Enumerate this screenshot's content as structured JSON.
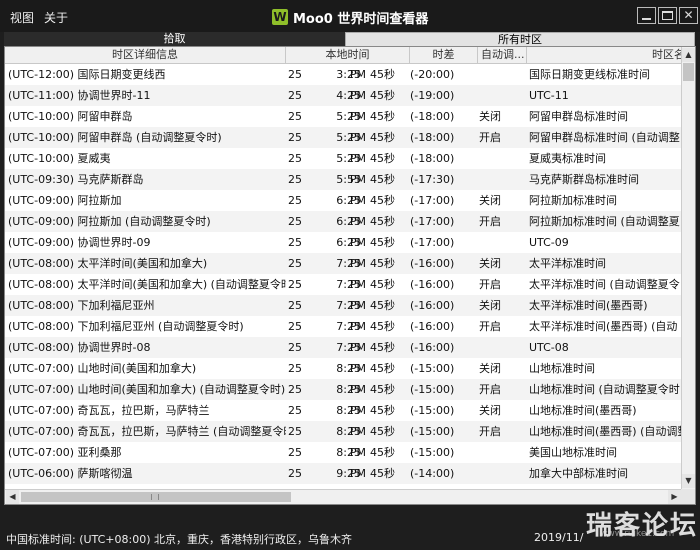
{
  "menu": {
    "view": "视图",
    "about": "关于"
  },
  "app": {
    "title": "Moo0 世界时间查看器",
    "logo_letter": "W",
    "logo_color": "#8fbf2a"
  },
  "tabs": [
    {
      "label": "拾取"
    },
    {
      "label": "所有时区"
    }
  ],
  "columns": {
    "name": "时区详细信息",
    "local": "本地时间",
    "offset": "时差",
    "dst": "自动调...",
    "zone": "时区名"
  },
  "rows": [
    {
      "name": "(UTC-12:00) 国际日期变更线西",
      "day": "25",
      "time": "3:25",
      "ampm": "PM",
      "sec": "45秒",
      "offset": "(-20:00)",
      "dst": "",
      "zone": "国际日期变更线标准时间"
    },
    {
      "name": "(UTC-11:00) 协调世界时-11",
      "day": "25",
      "time": "4:25",
      "ampm": "PM",
      "sec": "45秒",
      "offset": "(-19:00)",
      "dst": "",
      "zone": "UTC-11"
    },
    {
      "name": "(UTC-10:00) 阿留申群岛",
      "day": "25",
      "time": "5:25",
      "ampm": "PM",
      "sec": "45秒",
      "offset": "(-18:00)",
      "dst": "关闭",
      "zone": "阿留申群岛标准时间"
    },
    {
      "name": "(UTC-10:00) 阿留申群岛 (自动调整夏令时)",
      "day": "25",
      "time": "5:25",
      "ampm": "PM",
      "sec": "45秒",
      "offset": "(-18:00)",
      "dst": "开启",
      "zone": "阿留申群岛标准时间 (自动调整"
    },
    {
      "name": "(UTC-10:00) 夏威夷",
      "day": "25",
      "time": "5:25",
      "ampm": "PM",
      "sec": "45秒",
      "offset": "(-18:00)",
      "dst": "",
      "zone": "夏威夷标准时间"
    },
    {
      "name": "(UTC-09:30) 马克萨斯群岛",
      "day": "25",
      "time": "5:55",
      "ampm": "PM",
      "sec": "45秒",
      "offset": "(-17:30)",
      "dst": "",
      "zone": "马克萨斯群岛标准时间"
    },
    {
      "name": "(UTC-09:00) 阿拉斯加",
      "day": "25",
      "time": "6:25",
      "ampm": "PM",
      "sec": "45秒",
      "offset": "(-17:00)",
      "dst": "关闭",
      "zone": "阿拉斯加标准时间"
    },
    {
      "name": "(UTC-09:00) 阿拉斯加 (自动调整夏令时)",
      "day": "25",
      "time": "6:25",
      "ampm": "PM",
      "sec": "45秒",
      "offset": "(-17:00)",
      "dst": "开启",
      "zone": "阿拉斯加标准时间 (自动调整夏"
    },
    {
      "name": "(UTC-09:00) 协调世界时-09",
      "day": "25",
      "time": "6:25",
      "ampm": "PM",
      "sec": "45秒",
      "offset": "(-17:00)",
      "dst": "",
      "zone": "UTC-09"
    },
    {
      "name": "(UTC-08:00) 太平洋时间(美国和加拿大)",
      "day": "25",
      "time": "7:25",
      "ampm": "PM",
      "sec": "45秒",
      "offset": "(-16:00)",
      "dst": "关闭",
      "zone": "太平洋标准时间"
    },
    {
      "name": "(UTC-08:00) 太平洋时间(美国和加拿大) (自动调整夏令时)",
      "day": "25",
      "time": "7:25",
      "ampm": "PM",
      "sec": "45秒",
      "offset": "(-16:00)",
      "dst": "开启",
      "zone": "太平洋标准时间 (自动调整夏令"
    },
    {
      "name": "(UTC-08:00) 下加利福尼亚州",
      "day": "25",
      "time": "7:25",
      "ampm": "PM",
      "sec": "45秒",
      "offset": "(-16:00)",
      "dst": "关闭",
      "zone": "太平洋标准时间(墨西哥)"
    },
    {
      "name": "(UTC-08:00) 下加利福尼亚州 (自动调整夏令时)",
      "day": "25",
      "time": "7:25",
      "ampm": "PM",
      "sec": "45秒",
      "offset": "(-16:00)",
      "dst": "开启",
      "zone": "太平洋标准时间(墨西哥) (自动"
    },
    {
      "name": "(UTC-08:00) 协调世界时-08",
      "day": "25",
      "time": "7:25",
      "ampm": "PM",
      "sec": "45秒",
      "offset": "(-16:00)",
      "dst": "",
      "zone": "UTC-08"
    },
    {
      "name": "(UTC-07:00) 山地时间(美国和加拿大)",
      "day": "25",
      "time": "8:25",
      "ampm": "PM",
      "sec": "45秒",
      "offset": "(-15:00)",
      "dst": "关闭",
      "zone": "山地标准时间"
    },
    {
      "name": "(UTC-07:00) 山地时间(美国和加拿大) (自动调整夏令时)",
      "day": "25",
      "time": "8:25",
      "ampm": "PM",
      "sec": "45秒",
      "offset": "(-15:00)",
      "dst": "开启",
      "zone": "山地标准时间 (自动调整夏令时"
    },
    {
      "name": "(UTC-07:00) 奇瓦瓦，拉巴斯，马萨特兰",
      "day": "25",
      "time": "8:25",
      "ampm": "PM",
      "sec": "45秒",
      "offset": "(-15:00)",
      "dst": "关闭",
      "zone": "山地标准时间(墨西哥)"
    },
    {
      "name": "(UTC-07:00) 奇瓦瓦，拉巴斯，马萨特兰 (自动调整夏令时)",
      "day": "25",
      "time": "8:25",
      "ampm": "PM",
      "sec": "45秒",
      "offset": "(-15:00)",
      "dst": "开启",
      "zone": "山地标准时间(墨西哥) (自动调整"
    },
    {
      "name": "(UTC-07:00) 亚利桑那",
      "day": "25",
      "time": "8:25",
      "ampm": "PM",
      "sec": "45秒",
      "offset": "(-15:00)",
      "dst": "",
      "zone": "美国山地标准时间"
    },
    {
      "name": "(UTC-06:00) 萨斯喀彻温",
      "day": "25",
      "time": "9:25",
      "ampm": "PM",
      "sec": "45秒",
      "offset": "(-14:00)",
      "dst": "",
      "zone": "加拿大中部标准时间"
    }
  ],
  "status": {
    "left": "中国标准时间: (UTC+08:00) 北京，重庆，香港特别行政区，乌鲁木齐",
    "right": "2019/11/",
    "watermark": "瑞客论坛",
    "watermark_url": "www.ruike1.com"
  }
}
